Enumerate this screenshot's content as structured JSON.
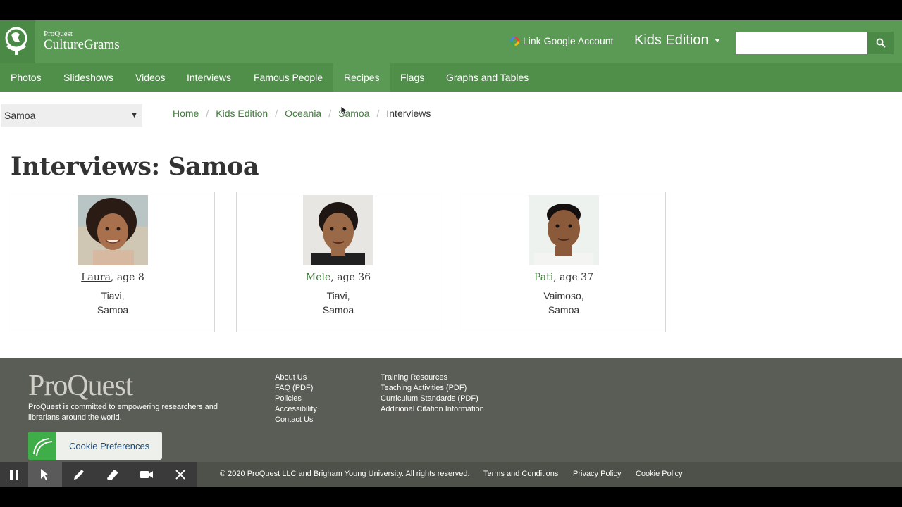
{
  "header": {
    "brand_small": "ProQuest",
    "brand_big": "CultureGrams",
    "google_link": "Link Google Account",
    "edition": "Kids Edition",
    "search_placeholder": ""
  },
  "nav": {
    "items": [
      {
        "label": "Photos"
      },
      {
        "label": "Slideshows"
      },
      {
        "label": "Videos"
      },
      {
        "label": "Interviews"
      },
      {
        "label": "Famous People"
      },
      {
        "label": "Recipes"
      },
      {
        "label": "Flags"
      },
      {
        "label": "Graphs and Tables"
      }
    ]
  },
  "country_select": {
    "value": "Samoa"
  },
  "breadcrumb": {
    "items": [
      "Home",
      "Kids Edition",
      "Oceania",
      "Samoa"
    ],
    "current": "Interviews"
  },
  "page_title": "Interviews: Samoa",
  "interviews": [
    {
      "name": "Laura",
      "age": ", age 8",
      "city": "Tiavi,",
      "country": "Samoa"
    },
    {
      "name": "Mele",
      "age": ", age 36",
      "city": "Tiavi,",
      "country": "Samoa"
    },
    {
      "name": "Pati",
      "age": ", age 37",
      "city": "Vaimoso,",
      "country": "Samoa"
    }
  ],
  "footer": {
    "logo": "ProQuest",
    "tagline": "ProQuest is committed to empowering researchers and librarians around the world.",
    "col1": [
      "About Us",
      "FAQ (PDF)",
      "Policies",
      "Accessibility",
      "Contact Us"
    ],
    "col2": [
      "Training Resources",
      "Teaching Activities (PDF)",
      "Curriculum Standards (PDF)",
      "Additional Citation Information"
    ],
    "cookie_button": "Cookie Preferences",
    "copyright": "© 2020 ProQuest LLC and Brigham Young University. All rights reserved.",
    "terms": "Terms and Conditions",
    "privacy": "Privacy Policy",
    "cookie_policy": "Cookie Policy"
  },
  "colors": {
    "header_green": "#5a9a55",
    "nav_green": "#4f8f4a",
    "link_green": "#3f7d3a",
    "footer_gray": "#5a5d55"
  }
}
